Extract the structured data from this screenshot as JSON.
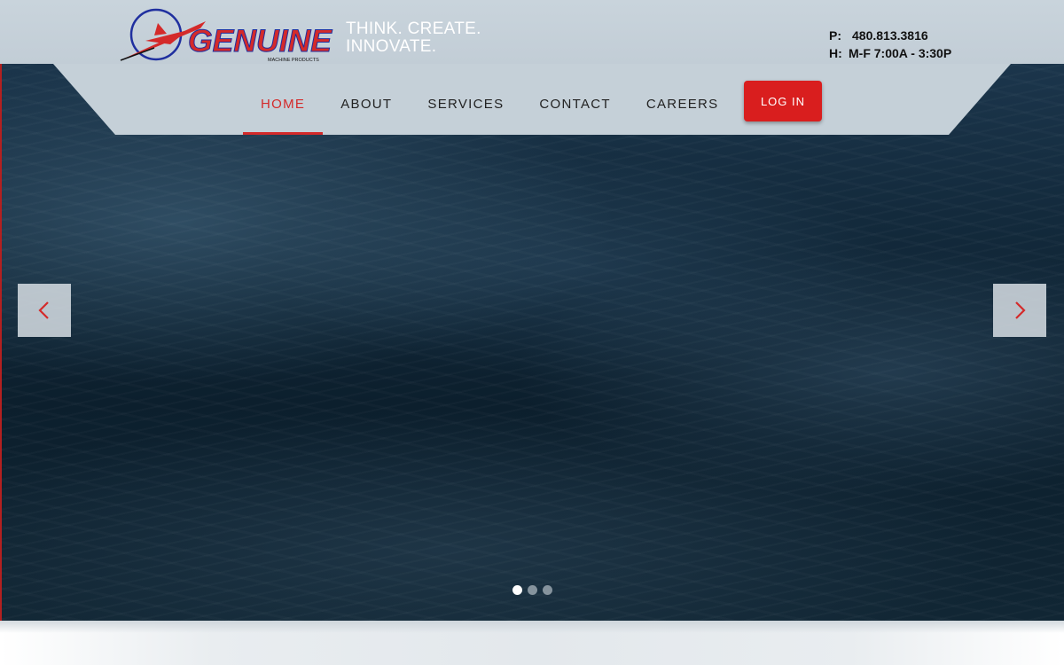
{
  "brand": {
    "logo_main": "GENUINE",
    "logo_sub": "MACHINE PRODUCTS",
    "colors": {
      "red": "#d42a2a",
      "blue": "#1f2f9f",
      "dark": "#111111"
    }
  },
  "tagline": {
    "line1": "THINK. CREATE.",
    "line2": "INNOVATE."
  },
  "contact": {
    "phone_label": "P:",
    "phone_value": "480.813.3816",
    "hours_label": "H:",
    "hours_value": "M-F 7:00A - 3:30P"
  },
  "nav": {
    "items": [
      {
        "label": "HOME"
      },
      {
        "label": "ABOUT"
      },
      {
        "label": "SERVICES"
      },
      {
        "label": "CONTACT"
      },
      {
        "label": "CAREERS"
      }
    ],
    "active_index": 0,
    "login_label": "LOG IN"
  },
  "slider": {
    "prev_icon": "chevron-left-icon",
    "next_icon": "chevron-right-icon",
    "slide_count": 3,
    "active_slide": 1
  }
}
